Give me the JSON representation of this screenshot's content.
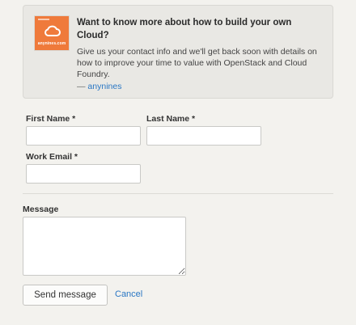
{
  "promo": {
    "title": "Want to know more about how to build your own Cloud?",
    "body": "Give us your contact info and we'll get back soon with details on how to improve your time to value with OpenStack and Cloud Foundry.",
    "signature_prefix": "— ",
    "signature_link": "anynines",
    "logo_text": "anynines.com",
    "logo_color": "#ef7a3b"
  },
  "form": {
    "first_name_label": "First Name *",
    "last_name_label": "Last Name *",
    "work_email_label": "Work Email *",
    "message_label": "Message",
    "first_name_value": "",
    "last_name_value": "",
    "work_email_value": "",
    "message_value": "",
    "send_label": "Send message",
    "cancel_label": "Cancel"
  },
  "colors": {
    "link": "#2a77c4",
    "background": "#f3f2ee"
  }
}
